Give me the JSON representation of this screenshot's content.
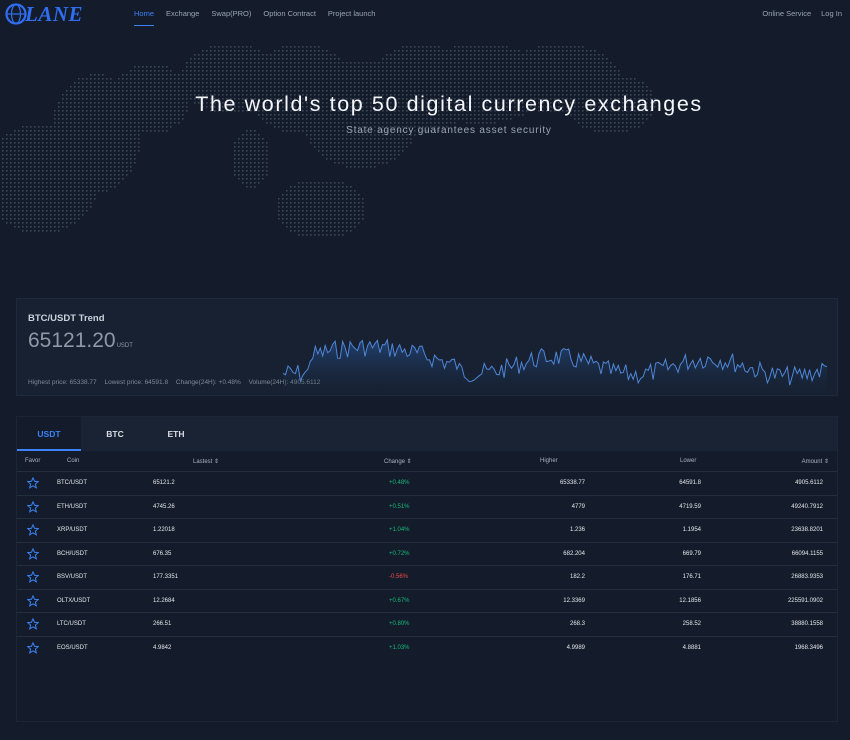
{
  "nav": {
    "logo_text": "LANE",
    "links": [
      "Home",
      "Exchange",
      "Swap(PRO)",
      "Option Contract",
      "Project launch"
    ],
    "right_links": [
      "Online Service",
      "Log In"
    ]
  },
  "hero": {
    "title": "The world's top 50 digital currency exchanges",
    "subtitle": "State agency guarantees asset security"
  },
  "trend": {
    "title": "BTC/USDT Trend",
    "price": "65121.20",
    "unit": "USDT",
    "stats": [
      "Highest price: 65338.77",
      "Lowest price: 64591.8",
      "Change(24H): +0.48%",
      "Volume(24H): 4905.6112"
    ]
  },
  "market": {
    "tabs": [
      "USDT",
      "BTC",
      "ETH"
    ],
    "columns": [
      "Favor",
      "Coin",
      "Lastest ⇕",
      "Change ⇕",
      "Higher",
      "Lower",
      "Amount ⇕"
    ],
    "rows": [
      {
        "coin": "BTC/USDT",
        "last": "65121.2",
        "change": "+0.48%",
        "high": "65338.77",
        "low": "64591.8",
        "amount": "4905.6112",
        "dir": "up"
      },
      {
        "coin": "ETH/USDT",
        "last": "4745.26",
        "change": "+0.51%",
        "high": "4779",
        "low": "4719.59",
        "amount": "49240.7912",
        "dir": "up"
      },
      {
        "coin": "XRP/USDT",
        "last": "1.22018",
        "change": "+1.04%",
        "high": "1.236",
        "low": "1.1954",
        "amount": "23638.8201",
        "dir": "up"
      },
      {
        "coin": "BCH/USDT",
        "last": "676.35",
        "change": "+0.72%",
        "high": "682.204",
        "low": "669.79",
        "amount": "66094.1155",
        "dir": "up"
      },
      {
        "coin": "BSV/USDT",
        "last": "177.3351",
        "change": "-0.56%",
        "high": "182.2",
        "low": "176.71",
        "amount": "26883.9353",
        "dir": "down"
      },
      {
        "coin": "OLTX/USDT",
        "last": "12.2684",
        "change": "+0.67%",
        "high": "12.3369",
        "low": "12.1856",
        "amount": "225591.0902",
        "dir": "up"
      },
      {
        "coin": "LTC/USDT",
        "last": "266.51",
        "change": "+0.80%",
        "high": "268.3",
        "low": "258.52",
        "amount": "38880.1558",
        "dir": "up"
      },
      {
        "coin": "EOS/USDT",
        "last": "4.9842",
        "change": "+1.03%",
        "high": "4.9989",
        "low": "4.8881",
        "amount": "1968.3496",
        "dir": "up"
      }
    ]
  },
  "colors": {
    "accent": "#3b82f6",
    "up": "#16b979",
    "down": "#f04a4a",
    "background": "#141c2b"
  },
  "icons": {
    "logo": "globe-logo-icon",
    "favorite": "star-icon"
  }
}
